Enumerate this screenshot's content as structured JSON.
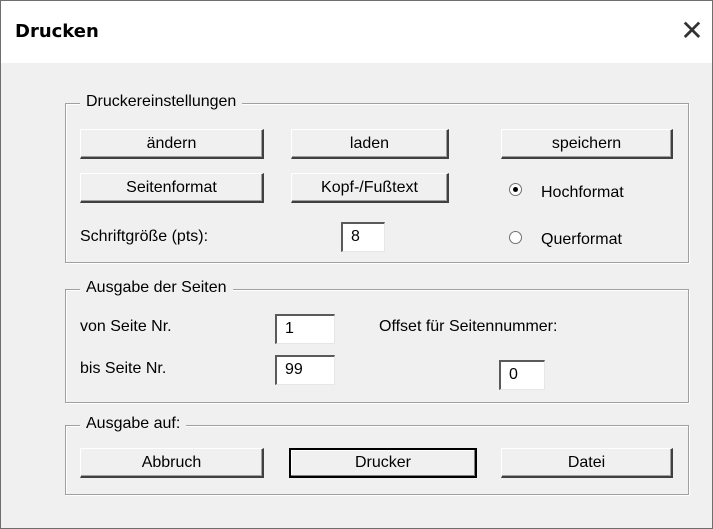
{
  "window": {
    "title": "Drucken",
    "close_glyph": "✕"
  },
  "printer_settings": {
    "legend": "Druckereinstellungen",
    "change_label": "ändern",
    "load_label": "laden",
    "save_label": "speichern",
    "page_format_label": "Seitenformat",
    "header_footer_label": "Kopf-/Fußtext",
    "font_size_label": "Schriftgröße (pts):",
    "font_size_value": "8",
    "orientation": {
      "portrait_label": "Hochformat",
      "landscape_label": "Querformat",
      "selected": "Hochformat"
    }
  },
  "page_output": {
    "legend": "Ausgabe der Seiten",
    "from_label": "von Seite Nr.",
    "from_value": "1",
    "to_label": "bis Seite Nr.",
    "to_value": "99",
    "offset_label": "Offset für Seitennummer:",
    "offset_value": "0"
  },
  "output_to": {
    "legend": "Ausgabe auf:",
    "cancel_label": "Abbruch",
    "printer_label": "Drucker",
    "file_label": "Datei"
  }
}
